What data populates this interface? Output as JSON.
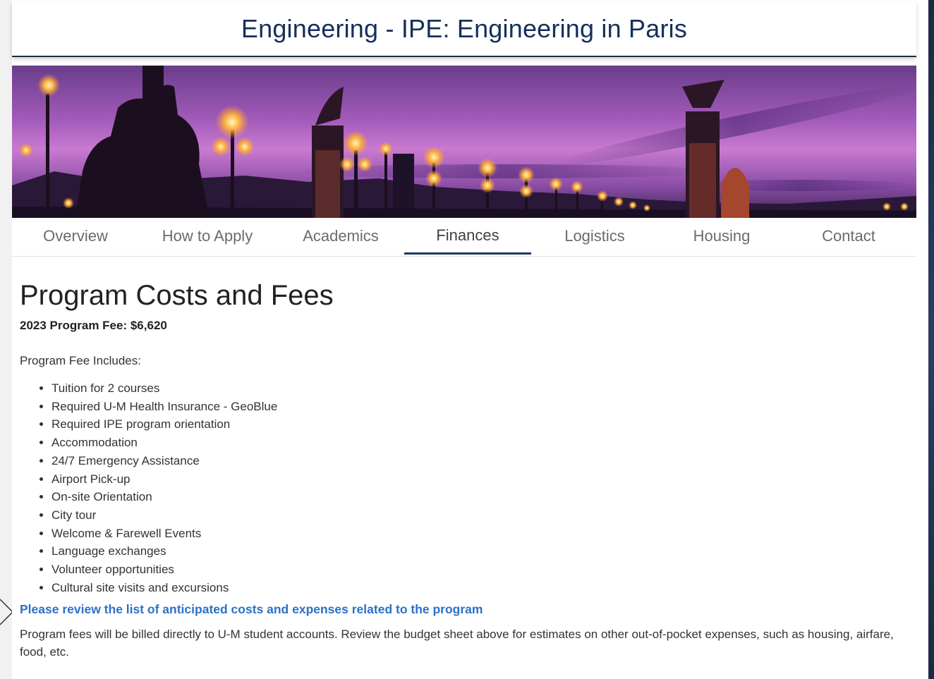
{
  "header": {
    "title": "Engineering - IPE: Engineering in Paris"
  },
  "banner": {
    "alt": "Paris bridge lamps at dusk"
  },
  "tabs": [
    {
      "label": "Overview"
    },
    {
      "label": "How to Apply"
    },
    {
      "label": "Academics"
    },
    {
      "label": "Finances",
      "active": true
    },
    {
      "label": "Logistics"
    },
    {
      "label": "Housing"
    },
    {
      "label": "Contact"
    }
  ],
  "main": {
    "heading": "Program Costs and Fees",
    "fee": "2023 Program Fee: $6,620",
    "includes_label": "Program Fee Includes:",
    "includes": [
      "Tuition for 2 courses",
      "Required U-M Health Insurance - GeoBlue",
      "Required IPE program orientation",
      "Accommodation",
      "24/7 Emergency Assistance",
      "Airport Pick-up",
      "On-site Orientation",
      "City tour",
      "Welcome & Farewell Events",
      "Language exchanges",
      "Volunteer opportunities",
      "Cultural site visits and excursions"
    ],
    "costs_link": "Please review the list of anticipated costs and expenses related to the program",
    "note": "Program fees will be billed directly to U-M student accounts. Review the budget sheet above for estimates on other out-of-pocket expenses, such as housing, airfare, food, etc."
  },
  "colors": {
    "accent": "#1c3a63",
    "link": "#2b71c7",
    "title": "#15305a"
  }
}
